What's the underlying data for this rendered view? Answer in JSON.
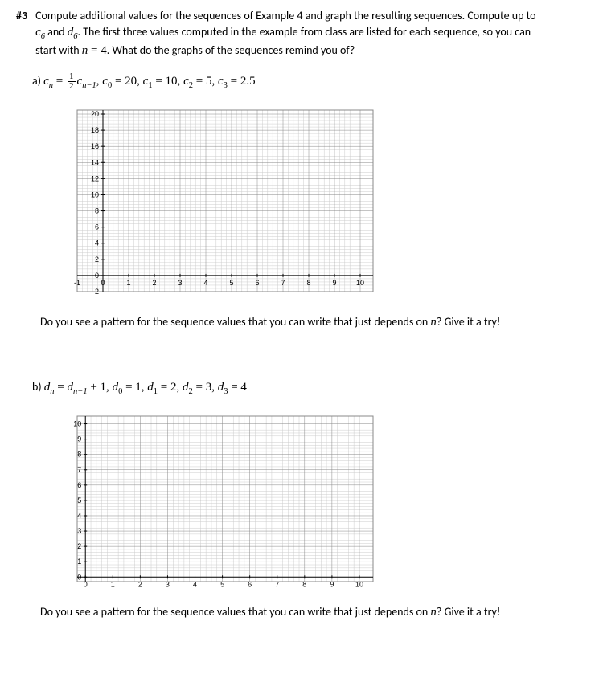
{
  "problem": {
    "number": "#3",
    "text_line1": "Compute additional values for the sequences of Example 4 and graph the resulting sequences. Compute up to",
    "text_line2_prefix": "",
    "text_line2_math_c": "c",
    "text_line2_math_csub": "6",
    "text_line2_and": " and ",
    "text_line2_math_d": "d",
    "text_line2_math_dsub": "6",
    "text_line2_suffix": ". The first three values computed in the example from class are listed for each sequence, so you can",
    "text_line3_prefix": "start with ",
    "text_line3_math_n": "n",
    "text_line3_eq": " = 4",
    "text_line3_suffix": ". What do the graphs of the sequences remind you of?"
  },
  "part_a": {
    "label": "a)",
    "eq_lhs_var": "c",
    "eq_lhs_sub": "n",
    "eq_eq1": " = ",
    "eq_frac_num": "1",
    "eq_frac_den": "2",
    "eq_rhs_var": "c",
    "eq_rhs_sub": "n−1",
    "eq_comma": ",  ",
    "c0": "c₀ = 20, ",
    "c1": "c₁ = 10, ",
    "c2": "c₂ = 5, ",
    "c3": "c₃ = 2.5"
  },
  "part_b": {
    "label": "b)",
    "eq_lhs_var": "d",
    "eq_lhs_sub": "n",
    "eq_eq1": " = ",
    "eq_rhs_var": "d",
    "eq_rhs_sub": "n−1",
    "eq_plus1": " + 1, ",
    "d0": "d₀ = 1, ",
    "d1": "d₁ = 2, ",
    "d2": "d₂ = 3, ",
    "d3": "d₃ = 4"
  },
  "prompt_text": "Do you see a pattern for the sequence values that you can write that just depends on ",
  "prompt_n": "n",
  "prompt_suffix": "? Give it a try!",
  "chart_data": [
    {
      "type": "scatter",
      "title": "",
      "xlabel": "",
      "ylabel": "",
      "x_ticks": [
        -1,
        0,
        1,
        2,
        3,
        4,
        5,
        6,
        7,
        8,
        9,
        10
      ],
      "y_ticks": [
        -2,
        0,
        2,
        4,
        6,
        8,
        10,
        12,
        14,
        16,
        18,
        20
      ],
      "xlim": [
        -1,
        10.5
      ],
      "ylim": [
        -2,
        20.5
      ],
      "x_minor": 5,
      "y_minor": 5,
      "series": []
    },
    {
      "type": "scatter",
      "title": "",
      "xlabel": "",
      "ylabel": "",
      "x_ticks": [
        0,
        1,
        2,
        3,
        4,
        5,
        6,
        7,
        8,
        9,
        10
      ],
      "y_ticks": [
        0,
        1,
        2,
        3,
        4,
        5,
        6,
        7,
        8,
        9,
        10
      ],
      "xlim": [
        -0.3,
        10.5
      ],
      "ylim": [
        -0.3,
        10.5
      ],
      "x_minor": 5,
      "y_minor": 5,
      "series": []
    }
  ]
}
